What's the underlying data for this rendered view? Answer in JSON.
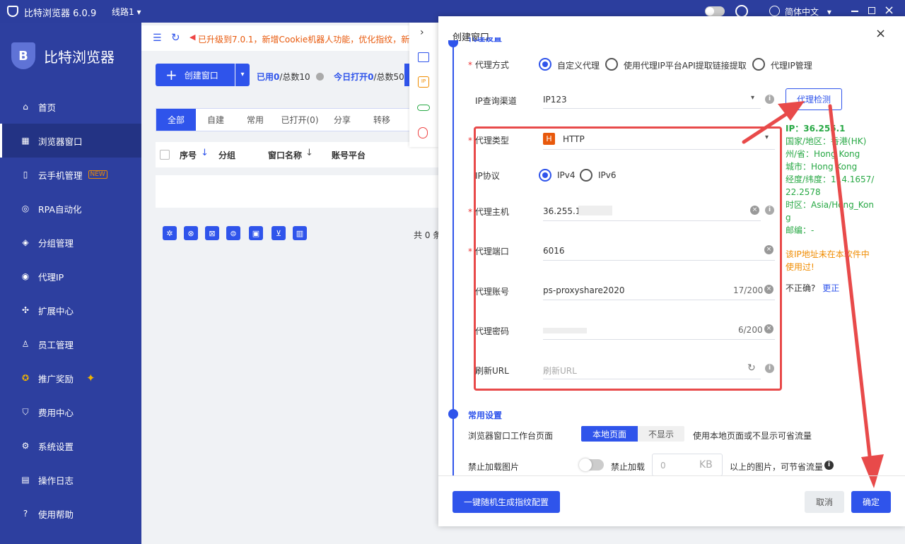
{
  "app": {
    "title": "比特浏览器 6.0.9",
    "line": "线路1",
    "language": "简体中文"
  },
  "sidebar": {
    "logo_text": "比特浏览器",
    "items": [
      {
        "label": "首页",
        "icon": "home-icon"
      },
      {
        "label": "浏览器窗口",
        "icon": "grid-icon"
      },
      {
        "label": "云手机管理",
        "icon": "phone-icon",
        "badge": "NEW"
      },
      {
        "label": "RPA自动化",
        "icon": "rpa-icon"
      },
      {
        "label": "分组管理",
        "icon": "layers-icon"
      },
      {
        "label": "代理IP",
        "icon": "location-icon"
      },
      {
        "label": "扩展中心",
        "icon": "extension-icon"
      },
      {
        "label": "员工管理",
        "icon": "users-icon"
      },
      {
        "label": "推广奖励",
        "icon": "reward-icon"
      },
      {
        "label": "费用中心",
        "icon": "shield-icon"
      },
      {
        "label": "系统设置",
        "icon": "gear-icon"
      },
      {
        "label": "操作日志",
        "icon": "log-icon"
      },
      {
        "label": "使用帮助",
        "icon": "help-icon"
      }
    ]
  },
  "main": {
    "notice": "已升级到7.0.1，新增Cookie机器人功能，优化指纹，新",
    "create_button": "创建窗口",
    "used_label": "已用",
    "used_value": "0",
    "total_label": "/总数10",
    "today_label": "今日打开",
    "today_value": "0",
    "today_total": "/总数50",
    "tabs": [
      "全部",
      "自建",
      "常用",
      "已打开(0)",
      "分享",
      "转移"
    ],
    "columns": [
      "序号",
      "分组",
      "窗口名称",
      "账号平台"
    ],
    "count_text": "共 0 条"
  },
  "modal": {
    "title": "创建窗口",
    "section_proxy_partial": "代理设置",
    "proxy_method_label": "代理方式",
    "proxy_methods": [
      "自定义代理",
      "使用代理IP平台API提取链接提取",
      "代理IP管理"
    ],
    "ip_channel_label": "IP查询渠道",
    "ip_channel_value": "IP123",
    "proxy_check_button": "代理检测",
    "proxy_type_label": "代理类型",
    "proxy_type_value": "HTTP",
    "proxy_type_badge": "H",
    "ip_protocol_label": "IP协议",
    "ip_protocols": [
      "IPv4",
      "IPv6"
    ],
    "host_label": "代理主机",
    "host_value": "36.255.1",
    "port_label": "代理端口",
    "port_value": "6016",
    "account_label": "代理账号",
    "account_value": "ps-proxyshare2020",
    "account_count": "17/200",
    "password_label": "代理密码",
    "password_count": "6/200",
    "refresh_label": "刷新URL",
    "refresh_placeholder": "刷新URL",
    "result": {
      "ip": "IP：36.255.1",
      "country": "国家/地区：香港(HK)",
      "state": "州/省：Hong Kong",
      "city": "城市：Hong Kong",
      "coords1": "经度/纬度：114.1657/",
      "coords2": "22.2578",
      "timezone1": "时区：Asia/Hong_Kon",
      "timezone2": "g",
      "postal": "邮编：-",
      "warning1": "该IP地址未在本软件中",
      "warning2": "使用过!",
      "incorrect": "不正确?",
      "fix_link": "更正"
    },
    "section_common": "常用设置",
    "workbench_label": "浏览器窗口工作台页面",
    "workbench_options": [
      "本地页面",
      "不显示"
    ],
    "workbench_hint": "使用本地页面或不显示可省流量",
    "block_images_label": "禁止加载图片",
    "block_toggle_text": "禁止加载",
    "kb_placeholder": "0",
    "kb_unit": "KB",
    "kb_hint": "以上的图片，可节省流量",
    "random_button": "一键随机生成指纹配置",
    "cancel_button": "取消",
    "confirm_button": "确定"
  },
  "colors": {
    "brand": "#2f54eb",
    "sidebar": "#2d3f9f",
    "annotation": "#e84a4a",
    "success": "#27a844",
    "warning": "#f08c00"
  }
}
